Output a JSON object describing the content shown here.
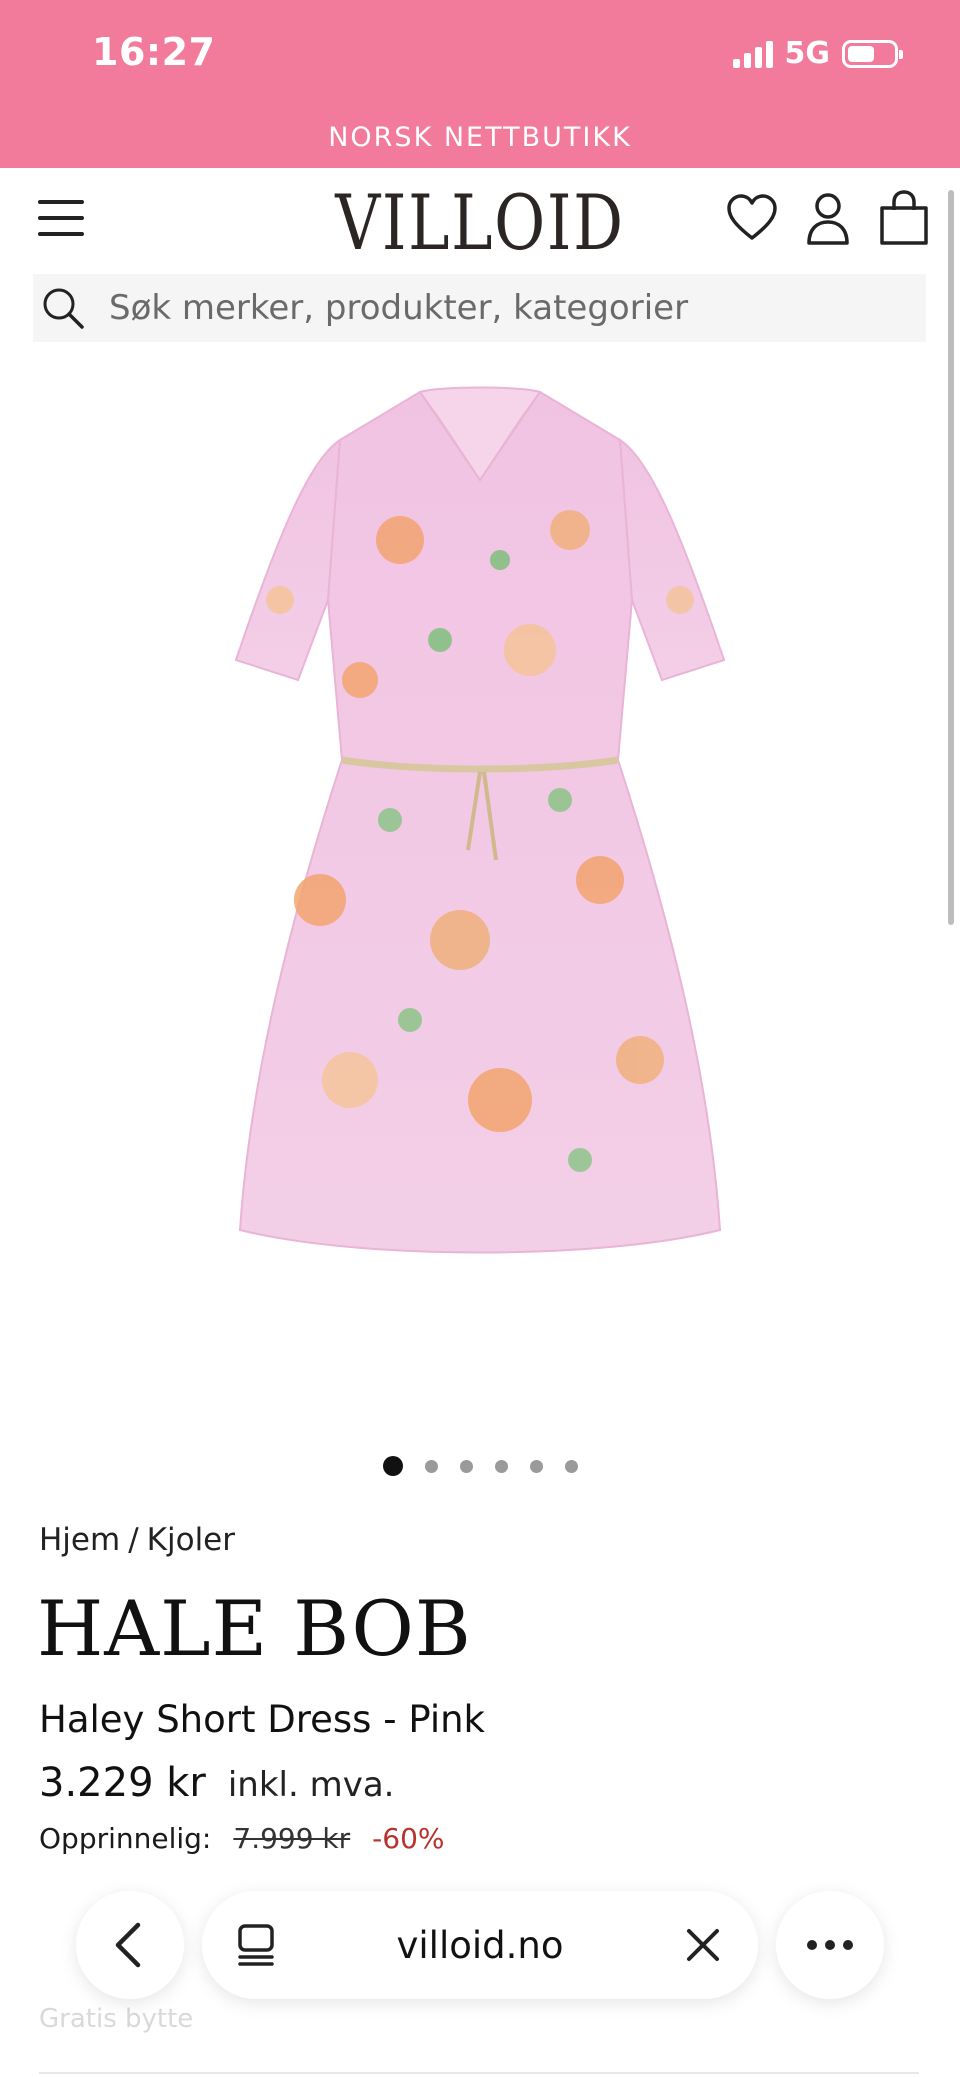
{
  "status_bar": {
    "time": "16:27",
    "network": "5G"
  },
  "banner": {
    "text": "NORSK NETTBUTIKK"
  },
  "header": {
    "logo": "VILLOID"
  },
  "search": {
    "placeholder": "Søk merker, produkter, kategorier"
  },
  "carousel": {
    "total": 6,
    "active": 1
  },
  "breadcrumb": {
    "items": [
      "Hjem",
      "Kjoler"
    ],
    "separator": "/"
  },
  "product": {
    "brand": "HALE BOB",
    "name": "Haley Short Dress - Pink",
    "price": "3.229 kr",
    "vat_note": "inkl. mva.",
    "original_label": "Opprinnelig:",
    "original_price": "7.999 kr",
    "discount": "-60%"
  },
  "below_fold": {
    "text": "Gratis bytte"
  },
  "browser": {
    "url": "villoid.no"
  },
  "colors": {
    "banner_bg": "#f27a9b",
    "discount": "#b8332d",
    "dress": "#f1c3e3"
  },
  "icons": [
    "menu-icon",
    "heart-icon",
    "user-icon",
    "bag-icon",
    "search-icon",
    "back-icon",
    "tabs-icon",
    "close-icon",
    "more-icon"
  ]
}
